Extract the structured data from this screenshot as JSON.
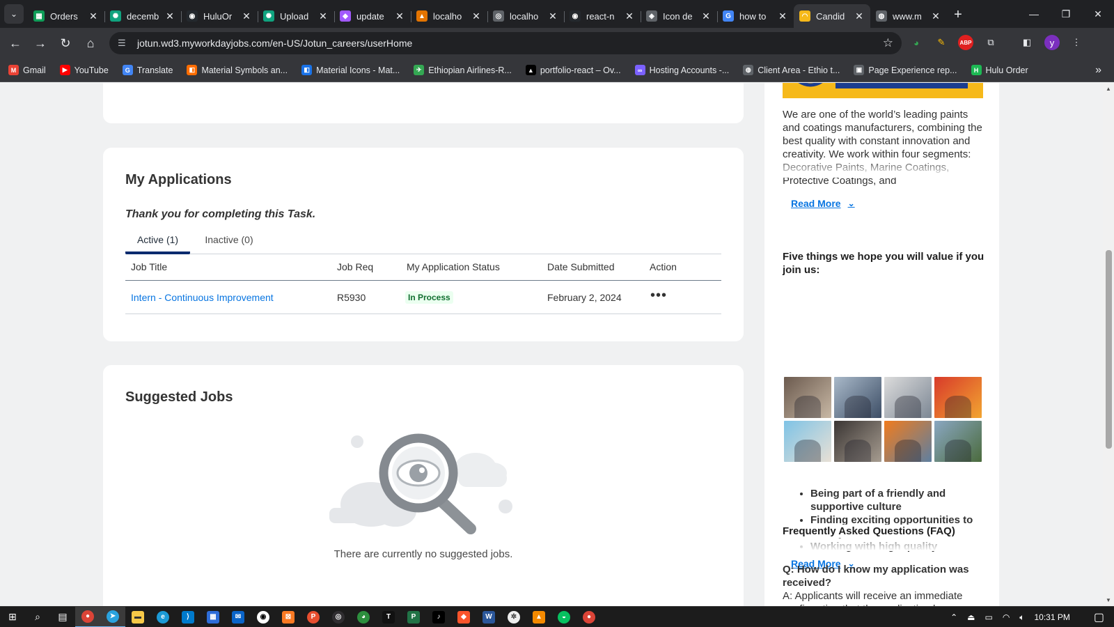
{
  "browser": {
    "tabs": [
      {
        "title": "Orders",
        "favicon": "sheets-icon",
        "color": "#0f9d58",
        "glyph": "▦"
      },
      {
        "title": "decemb",
        "favicon": "chatgpt-icon",
        "color": "#10a37f",
        "glyph": "✺"
      },
      {
        "title": "HuluOr",
        "favicon": "github-icon",
        "color": "#24292e",
        "glyph": "◉"
      },
      {
        "title": "Upload",
        "favicon": "chatgpt-icon",
        "color": "#10a37f",
        "glyph": "✺"
      },
      {
        "title": "update",
        "favicon": "figma-icon",
        "color": "#a259ff",
        "glyph": "◆"
      },
      {
        "title": "localho",
        "favicon": "localhost-icon",
        "color": "#e37400",
        "glyph": "▲"
      },
      {
        "title": "localho",
        "favicon": "localhost-icon",
        "color": "#5f6368",
        "glyph": "◎"
      },
      {
        "title": "react-n",
        "favicon": "github-icon",
        "color": "#24292e",
        "glyph": "◉"
      },
      {
        "title": "Icon de",
        "favicon": "icon-site-icon",
        "color": "#5f6368",
        "glyph": "◈"
      },
      {
        "title": "how to",
        "favicon": "google-icon",
        "color": "#4285f4",
        "glyph": "G"
      },
      {
        "title": "Candid",
        "favicon": "workday-icon",
        "color": "#f6b91a",
        "glyph": "◠",
        "active": true
      },
      {
        "title": "www.m",
        "favicon": "globe-icon",
        "color": "#5f6368",
        "glyph": "◍"
      }
    ],
    "url": "jotun.wd3.myworkdayjobs.com/en-US/Jotun_careers/userHome",
    "profile_initial": "y",
    "bookmarks": [
      {
        "label": "Gmail",
        "color": "#ea4335",
        "glyph": "M"
      },
      {
        "label": "YouTube",
        "color": "#ff0000",
        "glyph": "▶"
      },
      {
        "label": "Translate",
        "color": "#4285f4",
        "glyph": "G"
      },
      {
        "label": "Material Symbols an...",
        "color": "#ff6d00",
        "glyph": "◧"
      },
      {
        "label": "Material Icons - Mat...",
        "color": "#1a73e8",
        "glyph": "◧"
      },
      {
        "label": "Ethiopian Airlines-R...",
        "color": "#34a853",
        "glyph": "✈"
      },
      {
        "label": "portfolio-react – Ov...",
        "color": "#000000",
        "glyph": "▲"
      },
      {
        "label": "Hosting Accounts -...",
        "color": "#7b61ff",
        "glyph": "∞"
      },
      {
        "label": "Client Area - Ethio t...",
        "color": "#5f6368",
        "glyph": "◍"
      },
      {
        "label": "Page Experience rep...",
        "color": "#5f6368",
        "glyph": "▣"
      },
      {
        "label": "Hulu Order",
        "color": "#1db954",
        "glyph": "H"
      }
    ]
  },
  "page": {
    "applications": {
      "title": "My Applications",
      "message": "Thank you for completing this Task.",
      "tabs": [
        {
          "label": "Active (1)",
          "active": true
        },
        {
          "label": "Inactive (0)",
          "active": false
        }
      ],
      "columns": [
        "Job Title",
        "Job Req",
        "My Application Status",
        "Date Submitted",
        "Action"
      ],
      "rows": [
        {
          "job_title": "Intern - Continuous Improvement",
          "job_req": "R5930",
          "status": "In Process",
          "date": "February 2, 2024",
          "action": "•••"
        }
      ]
    },
    "suggested": {
      "title": "Suggested Jobs",
      "empty_message": "There are currently no suggested jobs."
    }
  },
  "sidebar": {
    "about": "We are one of the world’s leading paints and coatings manufacturers, combining the best quality with constant innovation and creativity. We work within four segments: Decorative Paints, Marine Coatings, Protective Coatings, and",
    "read_more": "Read More",
    "values_heading": "Five things we hope you will value if you join us:",
    "values": [
      "Being part of a friendly and supportive culture",
      "Finding exciting opportunities to build your career",
      "Working with high quality"
    ],
    "faq_heading": "Frequently Asked Questions (FAQ)",
    "faq_q": "Q: How do I know my application was received?",
    "faq_a": "A: Applicants will receive an immediate confirmation that the application has"
  },
  "taskbar": {
    "time": "10:31 PM"
  }
}
